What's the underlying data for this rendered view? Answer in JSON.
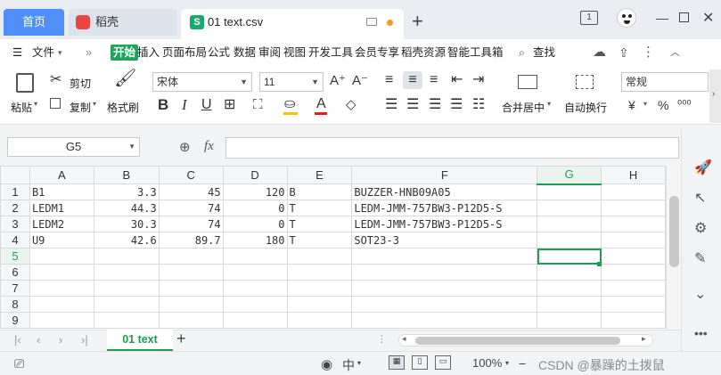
{
  "titlebar": {
    "tabs": [
      {
        "label": "首页"
      },
      {
        "label": "稻壳"
      },
      {
        "label": "01 text.csv"
      }
    ],
    "csv_logo": "S",
    "page_indicator": "1"
  },
  "menubar": {
    "file": "文件",
    "items": [
      "开始",
      "插入",
      "页面布局",
      "公式",
      "数据",
      "审阅",
      "视图",
      "开发工具",
      "会员专享",
      "稻壳资源",
      "智能工具箱"
    ],
    "search": "查找"
  },
  "ribbon": {
    "paste": "粘贴",
    "cut": "剪切",
    "copy": "复制",
    "format_painter": "格式刷",
    "font_name": "宋体",
    "font_size": "11",
    "merge_center": "合并居中",
    "wrap_text": "自动换行",
    "number_format": "常规",
    "currency": "¥",
    "percent": "%"
  },
  "formula": {
    "cell_ref": "G5",
    "fx": "fx",
    "value": ""
  },
  "sheet": {
    "columns": [
      "A",
      "B",
      "C",
      "D",
      "E",
      "F",
      "G",
      "H"
    ],
    "active_col": "G",
    "active_row": "5",
    "rows": [
      {
        "n": "1",
        "a": "B1",
        "b": "3.3",
        "c": "45",
        "d": "120",
        "e": "B",
        "f": "BUZZER-HNB09A05"
      },
      {
        "n": "2",
        "a": "LEDM1",
        "b": "44.3",
        "c": "74",
        "d": "0",
        "e": "T",
        "f": "LEDM-JMM-757BW3-P12D5-S"
      },
      {
        "n": "3",
        "a": "LEDM2",
        "b": "30.3",
        "c": "74",
        "d": "0",
        "e": "T",
        "f": "LEDM-JMM-757BW3-P12D5-S"
      },
      {
        "n": "4",
        "a": "U9",
        "b": "42.6",
        "c": "89.7",
        "d": "180",
        "e": "T",
        "f": "SOT23-3"
      },
      {
        "n": "5",
        "a": "",
        "b": "",
        "c": "",
        "d": "",
        "e": "",
        "f": ""
      },
      {
        "n": "6",
        "a": "",
        "b": "",
        "c": "",
        "d": "",
        "e": "",
        "f": ""
      },
      {
        "n": "7",
        "a": "",
        "b": "",
        "c": "",
        "d": "",
        "e": "",
        "f": ""
      },
      {
        "n": "8",
        "a": "",
        "b": "",
        "c": "",
        "d": "",
        "e": "",
        "f": ""
      },
      {
        "n": "9",
        "a": "",
        "b": "",
        "c": "",
        "d": "",
        "e": "",
        "f": ""
      }
    ]
  },
  "sheet_tabs": {
    "active": "01 text"
  },
  "status": {
    "zoom": "100%",
    "watermark": "CSDN @暴躁的土拨鼠"
  },
  "colors": {
    "accent_green": "#1f9d55",
    "home_tab_blue": "#4f8ff7"
  }
}
